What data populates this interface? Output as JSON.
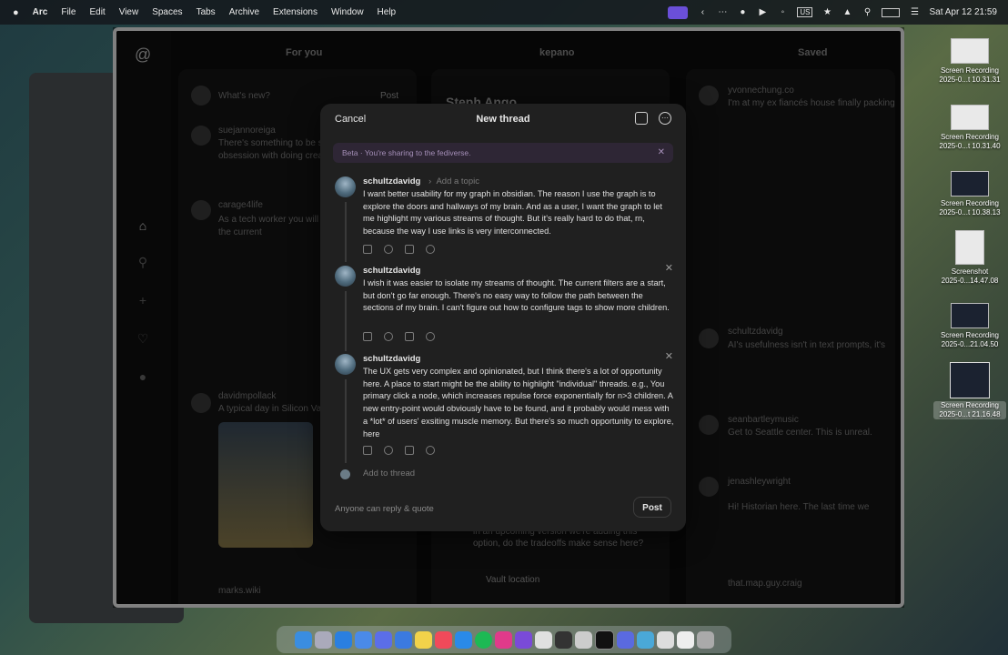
{
  "menubar": {
    "items": [
      "Arc",
      "File",
      "Edit",
      "View",
      "Spaces",
      "Tabs",
      "Archive",
      "Extensions",
      "Window",
      "Help"
    ],
    "input_label": "US",
    "datetime": "Sat Apr 12  21:59"
  },
  "threads": {
    "columns": {
      "for_you": "For you",
      "profile": "kepano",
      "saved": "Saved"
    },
    "bg_texts": {
      "compose_placeholder": "What's new?",
      "compose_post": "Post",
      "profile_name": "Steph Ango",
      "u1": "suejannoreiga",
      "t1": "There's something to be s",
      "t1b": "obsession with doing crea",
      "u2": "carage4life",
      "t2": "As a tech worker you will r",
      "t2b": "the current",
      "u3": "davidmpollack",
      "t3": "A typical day in Silicon Val",
      "u4": "marks.wiki",
      "s1": "yvonnechung.co",
      "s1t": "I'm at my ex fiancés house finally packing",
      "s2": "schultzdavidg",
      "s2t": "AI's usefulness isn't in text prompts, it's",
      "s3": "seanbartleymusic",
      "s3t": "Get to Seattle center. This is unreal.",
      "s4": "jenashleywright",
      "s4t": "Hi! Historian here. The last time we",
      "s5": "that.map.guy.craig",
      "vault_q": "in an upcoming version we're adding this option, do the tradeoffs make sense here?",
      "vault": "Vault location"
    }
  },
  "modal": {
    "cancel": "Cancel",
    "title": "New thread",
    "beta": "Beta · You're sharing to the fediverse.",
    "topic": "Add a topic",
    "posts": [
      {
        "user": "schultzdavidg",
        "text": "I want better usability for my graph in obsidian. The reason I use the graph is to explore the doors and hallways of my brain. And as a user, I want the graph to let me highlight my various streams of thought. But it's really hard to do that, rn, because the way I use links is very interconnected."
      },
      {
        "user": "schultzdavidg",
        "text": "I wish it was easier to isolate my streams of thought. The current filters are a start, but don't go far enough. There's no easy way to follow the path between the sections of my brain. I can't figure out how to configure tags to show more children."
      },
      {
        "user": "schultzdavidg",
        "text": "The UX gets very complex and opinionated, but I think there's a lot of opportunity here. A place to start might be the ability to highlight \"individual\" threads. e.g., You primary click a node, which increases repulse force exponentially for n>3 children. A new entry-point would obviously have to be found, and it probably would mess with a *lot* of users' exsiting muscle memory. But there's so much opportunity to explore, here"
      }
    ],
    "add_to_thread": "Add to thread",
    "reply_setting": "Anyone can reply & quote",
    "post": "Post"
  },
  "desktop": [
    {
      "label1": "Screen Recording",
      "label2": "2025-0...t 10.31.31"
    },
    {
      "label1": "Screen Recording",
      "label2": "2025-0...t 10.31.40"
    },
    {
      "label1": "Screen Recording",
      "label2": "2025-0...t 10.38.13"
    },
    {
      "label1": "Screenshot",
      "label2": "2025-0...14.47.08"
    },
    {
      "label1": "Screen Recording",
      "label2": "2025-0...21.04.50"
    },
    {
      "label1": "Screen Recording",
      "label2": "2025-0...t 21.16.48"
    }
  ]
}
